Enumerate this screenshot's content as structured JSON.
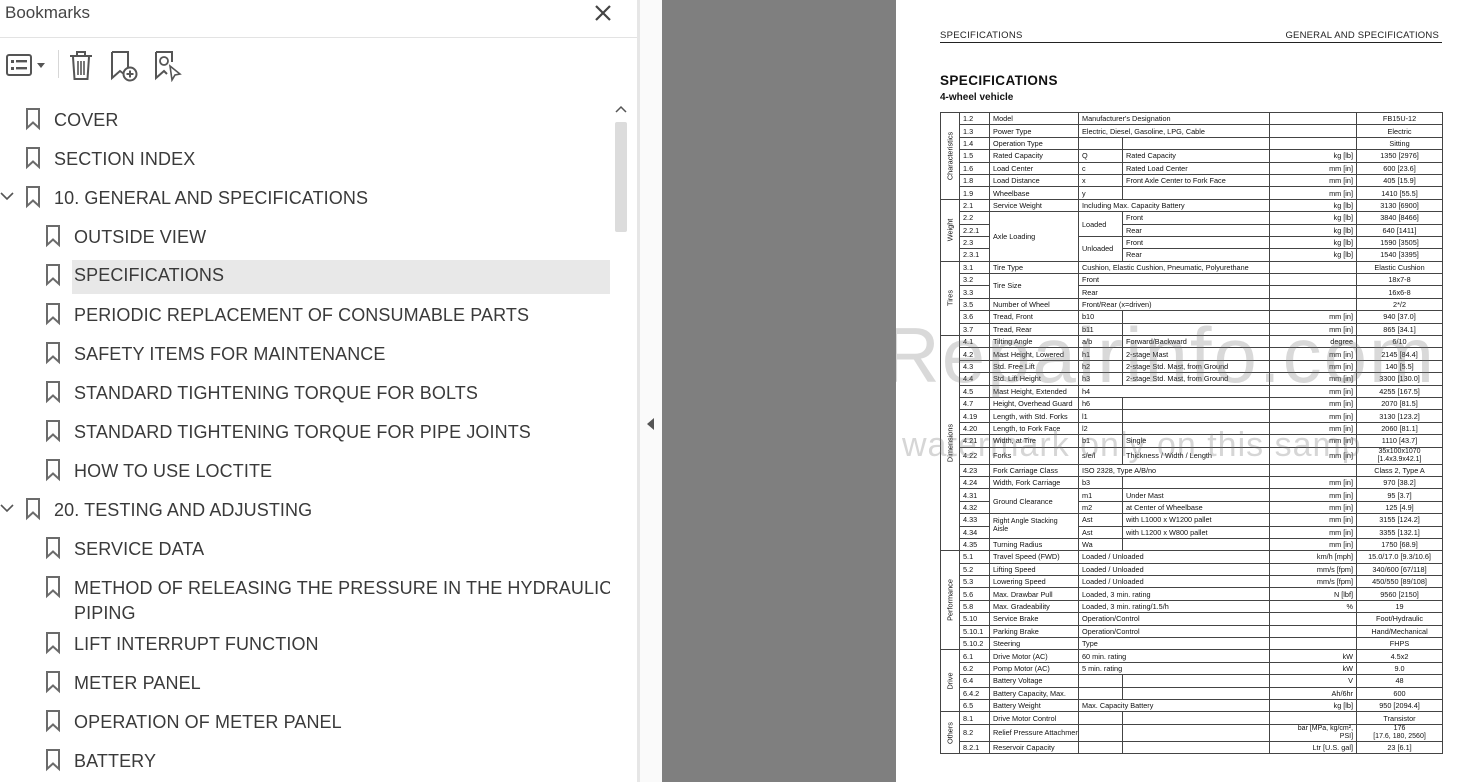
{
  "panel": {
    "title": "Bookmarks",
    "close_icon": "close-icon",
    "toolbar": {
      "options_icon": "bookmark-options-icon",
      "delete_icon": "trash-icon",
      "add_icon": "add-bookmark-icon",
      "find_icon": "find-bookmark-icon"
    }
  },
  "bookmarks": [
    {
      "label": "COVER",
      "level": 0,
      "expandable": false,
      "selected": false
    },
    {
      "label": "SECTION INDEX",
      "level": 0,
      "expandable": false,
      "selected": false
    },
    {
      "label": "10. GENERAL AND SPECIFICATIONS",
      "level": 0,
      "expandable": true,
      "selected": false
    },
    {
      "label": "OUTSIDE VIEW",
      "level": 1,
      "expandable": false,
      "selected": false
    },
    {
      "label": "SPECIFICATIONS",
      "level": 1,
      "expandable": false,
      "selected": true
    },
    {
      "label": "PERIODIC REPLACEMENT OF CONSUMABLE PARTS",
      "level": 1,
      "expandable": false,
      "selected": false
    },
    {
      "label": "SAFETY ITEMS FOR MAINTENANCE",
      "level": 1,
      "expandable": false,
      "selected": false
    },
    {
      "label": "STANDARD TIGHTENING TORQUE FOR BOLTS",
      "level": 1,
      "expandable": false,
      "selected": false
    },
    {
      "label": "STANDARD TIGHTENING TORQUE FOR PIPE JOINTS",
      "level": 1,
      "expandable": false,
      "selected": false
    },
    {
      "label": "HOW TO USE LOCTITE",
      "level": 1,
      "expandable": false,
      "selected": false
    },
    {
      "label": "20. TESTING AND ADJUSTING",
      "level": 0,
      "expandable": true,
      "selected": false
    },
    {
      "label": "SERVICE DATA",
      "level": 1,
      "expandable": false,
      "selected": false
    },
    {
      "label": "METHOD OF RELEASING THE PRESSURE IN THE HYDRAULIC",
      "label2": "PIPING",
      "level": 1,
      "expandable": false,
      "selected": false
    },
    {
      "label": "LIFT INTERRUPT FUNCTION",
      "level": 1,
      "expandable": false,
      "selected": false
    },
    {
      "label": "METER PANEL",
      "level": 1,
      "expandable": false,
      "selected": false
    },
    {
      "label": "OPERATION OF METER PANEL",
      "level": 1,
      "expandable": false,
      "selected": false
    },
    {
      "label": "BATTERY",
      "level": 1,
      "expandable": false,
      "selected": false
    }
  ],
  "document": {
    "header_left": "SPECIFICATIONS",
    "header_right": "GENERAL AND SPECIFICATIONS",
    "title": "SPECIFICATIONS",
    "subtitle": "4-wheel vehicle",
    "watermark_1": "eRepairinfo.com",
    "watermark_2": "watermark only on this samp",
    "groups": {
      "g1": "Characteristics",
      "g2": "Weight",
      "g3": "Tires",
      "g4": "Dimensions",
      "g5": "Performance",
      "g6": "Drive",
      "g7": "Others"
    },
    "rows": [
      {
        "no": "1.2",
        "name": "Model",
        "a": "Manufacturer's Designation",
        "b": "",
        "unit": "",
        "val": "FB15U-12"
      },
      {
        "no": "1.3",
        "name": "Power Type",
        "a": "Electric, Diesel, Gasoline, LPG, Cable",
        "b": "",
        "unit": "",
        "val": "Electric"
      },
      {
        "no": "1.4",
        "name": "Operation Type",
        "a": "",
        "b": "",
        "unit": "",
        "val": "Sitting"
      },
      {
        "no": "1.5",
        "name": "Rated Capacity",
        "a": "Q",
        "b": "Rated Capacity",
        "unit": "kg [lb]",
        "val": "1350 [2976]"
      },
      {
        "no": "1.6",
        "name": "Load Center",
        "a": "c",
        "b": "Rated Load Center",
        "unit": "mm [in]",
        "val": "600 [23.6]"
      },
      {
        "no": "1.8",
        "name": "Load Distance",
        "a": "x",
        "b": "Front Axle Center to Fork Face",
        "unit": "mm [in]",
        "val": "405 [15.9]"
      },
      {
        "no": "1.9",
        "name": "Wheelbase",
        "a": "y",
        "b": "",
        "unit": "mm [in]",
        "val": "1410 [55.5]"
      },
      {
        "no": "2.1",
        "name": "Service Weight",
        "a": "Including Max. Capacity Battery",
        "b": "",
        "unit": "kg [lb]",
        "val": "3130 [6900]"
      },
      {
        "no": "2.2",
        "name": "Axle Loading",
        "a": "Loaded",
        "b": "Front",
        "unit": "kg [lb]",
        "val": "3840 [8466]"
      },
      {
        "no": "2.2.1",
        "name": "",
        "a": "",
        "b": "Rear",
        "unit": "kg [lb]",
        "val": "640 [1411]"
      },
      {
        "no": "2.3",
        "name": "",
        "a": "Unloaded",
        "b": "Front",
        "unit": "kg [lb]",
        "val": "1590 [3505]"
      },
      {
        "no": "2.3.1",
        "name": "",
        "a": "",
        "b": "Rear",
        "unit": "kg [lb]",
        "val": "1540 [3395]"
      },
      {
        "no": "3.1",
        "name": "Tire Type",
        "a": "Cushion, Elastic Cushion, Pneumatic, Polyurethane",
        "b": "",
        "unit": "",
        "val": "Elastic Cushion"
      },
      {
        "no": "3.2",
        "name": "Tire Size",
        "a": "Front",
        "b": "",
        "unit": "",
        "val": "18x7-8"
      },
      {
        "no": "3.3",
        "name": "",
        "a": "Rear",
        "b": "",
        "unit": "",
        "val": "16x6-8"
      },
      {
        "no": "3.5",
        "name": "Number of Wheel",
        "a": "Front/Rear (x=driven)",
        "b": "",
        "unit": "",
        "val": "2*/2"
      },
      {
        "no": "3.6",
        "name": "Tread, Front",
        "a": "b10",
        "b": "",
        "unit": "mm [in]",
        "val": "940 [37.0]"
      },
      {
        "no": "3.7",
        "name": "Tread, Rear",
        "a": "b11",
        "b": "",
        "unit": "mm [in]",
        "val": "865 [34.1]"
      },
      {
        "no": "4.1",
        "name": "Tilting Angle",
        "a": "a/b",
        "b": "Forward/Backward",
        "unit": "degree",
        "val": "6/10"
      },
      {
        "no": "4.2",
        "name": "Mast Height, Lowered",
        "a": "h1",
        "b": "2-stage  Mast",
        "unit": "mm [in]",
        "val": "2145 [84.4]"
      },
      {
        "no": "4.3",
        "name": "Std. Free Lift",
        "a": "h2",
        "b": "2-stage Std. Mast, from Ground",
        "unit": "mm [in]",
        "val": "140 [5.5]"
      },
      {
        "no": "4.4",
        "name": "Std. Lift Height",
        "a": "h3",
        "b": "2-stage Std. Mast, from Ground",
        "unit": "mm [in]",
        "val": "3300 [130.0]"
      },
      {
        "no": "4.5",
        "name": "Mast Height, Extended",
        "a": "h4",
        "b": "2-stage Std. Mast",
        "unit": "mm [in]",
        "val": "4255 [167.5]"
      },
      {
        "no": "4.7",
        "name": "Height, Overhead Guard",
        "a": "h6",
        "b": "",
        "unit": "mm [in]",
        "val": "2070 [81.5]"
      },
      {
        "no": "4.19",
        "name": "Length, with Std. Forks",
        "a": "l1",
        "b": "",
        "unit": "mm [in]",
        "val": "3130 [123.2]"
      },
      {
        "no": "4.20",
        "name": "Length, to Fork Face",
        "a": "l2",
        "b": "",
        "unit": "mm [in]",
        "val": "2060 [81.1]"
      },
      {
        "no": "4.21",
        "name": "Width, at Tire",
        "a": "b1",
        "b": "Single",
        "unit": "mm [in]",
        "val": "1110 [43.7]"
      },
      {
        "no": "4.22",
        "name": "Forks",
        "a": "s/e/l",
        "b": "Thickness / Width / Length",
        "unit": "mm [in]",
        "val": "35x100x1070",
        "val2": "[1.4x3.9x42.1]"
      },
      {
        "no": "4.23",
        "name": "Fork Carriage Class",
        "a": "ISO 2328, Type A/B/no",
        "b": "",
        "unit": "",
        "val": "Class 2, Type A"
      },
      {
        "no": "4.24",
        "name": "Width, Fork Carriage",
        "a": "b3",
        "b": "",
        "unit": "mm [in]",
        "val": "970 [38.2]"
      },
      {
        "no": "4.31",
        "name": "Ground Clearance",
        "a": "m1",
        "b": "Under Mast",
        "unit": "mm [in]",
        "val": "95 [3.7]"
      },
      {
        "no": "4.32",
        "name": "",
        "a": "m2",
        "b": "at Center of Wheelbase",
        "unit": "mm [in]",
        "val": "125 [4.9]"
      },
      {
        "no": "4.33",
        "name": "Right Angle Stacking",
        "name2": "Aisle",
        "a": "Ast",
        "b": "with L1000 x W1200 pallet",
        "unit": "mm [in]",
        "val": "3155 [124.2]"
      },
      {
        "no": "4.34",
        "name": "",
        "a": "Ast",
        "b": "with L1200 x W800 pallet",
        "unit": "mm [in]",
        "val": "3355 [132.1]"
      },
      {
        "no": "4.35",
        "name": "Turning Radius",
        "a": "Wa",
        "b": "",
        "unit": "mm [in]",
        "val": "1750 [68.9]"
      },
      {
        "no": "5.1",
        "name": "Travel Speed (FWD)",
        "a": "Loaded / Unloaded",
        "b": "",
        "unit": "km/h [mph]",
        "val": "15.0/17.0 [9.3/10.6]"
      },
      {
        "no": "5.2",
        "name": "Lifting Speed",
        "a": "Loaded / Unloaded",
        "b": "",
        "unit": "mm/s [fpm]",
        "val": "340/600 [67/118]"
      },
      {
        "no": "5.3",
        "name": "Lowering Speed",
        "a": "Loaded / Unloaded",
        "b": "",
        "unit": "mm/s [fpm]",
        "val": "450/550 [89/108]"
      },
      {
        "no": "5.6",
        "name": "Max. Drawbar Pull",
        "a": "Loaded, 3 min. rating",
        "b": "",
        "unit": "N [lbf]",
        "val": "9560 [2150]"
      },
      {
        "no": "5.8",
        "name": "Max. Gradeability",
        "a": "Loaded, 3 min. rating/1.5/h",
        "b": "",
        "unit": "%",
        "val": "19"
      },
      {
        "no": "5.10",
        "name": "Service Brake",
        "a": "Operation/Control",
        "b": "",
        "unit": "",
        "val": "Foot/Hydraulic"
      },
      {
        "no": "5.10.1",
        "name": "Parking Brake",
        "a": "Operation/Control",
        "b": "",
        "unit": "",
        "val": "Hand/Mechanical"
      },
      {
        "no": "5.10.2",
        "name": "Steering",
        "a": "Type",
        "b": "",
        "unit": "",
        "val": "FHPS"
      },
      {
        "no": "6.1",
        "name": "Drive Motor (AC)",
        "a": "60 min. rating",
        "b": "",
        "unit": "kW",
        "val": "4.5x2"
      },
      {
        "no": "6.2",
        "name": "Pomp Motor (AC)",
        "a": "5  min. rating",
        "b": "",
        "unit": "kW",
        "val": "9.0"
      },
      {
        "no": "6.4",
        "name": "Battery Voltage",
        "a": "",
        "b": "",
        "unit": "V",
        "val": "48"
      },
      {
        "no": "6.4.2",
        "name": "Battery Capacity, Max.",
        "a": "",
        "b": "",
        "unit": "Ah/6hr",
        "val": "600"
      },
      {
        "no": "6.5",
        "name": "Battery Weight",
        "a": "Max. Capacity Battery",
        "b": "",
        "unit": "kg [lb]",
        "val": "950 [2094.4]"
      },
      {
        "no": "8.1",
        "name": "Drive Motor Control",
        "a": "",
        "b": "",
        "unit": "",
        "val": "Transistor"
      },
      {
        "no": "8.2",
        "name": "Relief Pressure Attachment",
        "a": "",
        "b": "",
        "unit": "bar [MPa, kg/cm²,",
        "unit2": "PSI]",
        "val": "176",
        "val2": "[17.6, 180, 2560]"
      },
      {
        "no": "8.2.1",
        "name": "Reservoir Capacity",
        "a": "",
        "b": "",
        "unit": "Ltr [U.S. gal]",
        "val": "23 [6.1]"
      }
    ]
  }
}
